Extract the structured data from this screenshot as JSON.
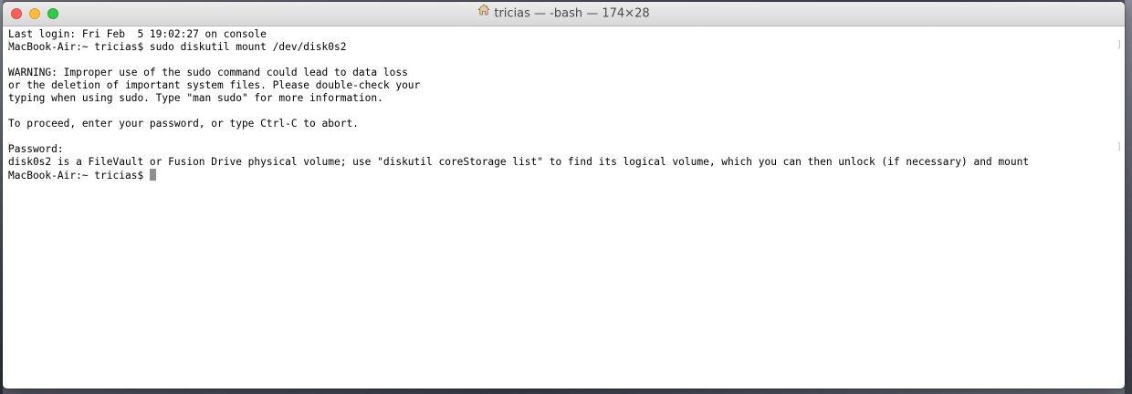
{
  "window": {
    "title": "tricias — -bash — 174×28",
    "title_icon": "home-icon"
  },
  "terminal": {
    "lines": [
      "Last login: Fri Feb  5 19:02:27 on console",
      "MacBook-Air:~ tricias$ sudo diskutil mount /dev/disk0s2",
      "",
      "WARNING: Improper use of the sudo command could lead to data loss",
      "or the deletion of important system files. Please double-check your",
      "typing when using sudo. Type \"man sudo\" for more information.",
      "",
      "To proceed, enter your password, or type Ctrl-C to abort.",
      "",
      "Password:",
      "disk0s2 is a FileVault or Fusion Drive physical volume; use \"diskutil coreStorage list\" to find its logical volume, which you can then unlock (if necessary) and mount"
    ],
    "prompt": "MacBook-Air:~ tricias$ "
  },
  "colors": {
    "close": "#fc605c",
    "minimize": "#fdbc40",
    "zoom": "#34c84a",
    "cursor": "#8e8e8e"
  }
}
